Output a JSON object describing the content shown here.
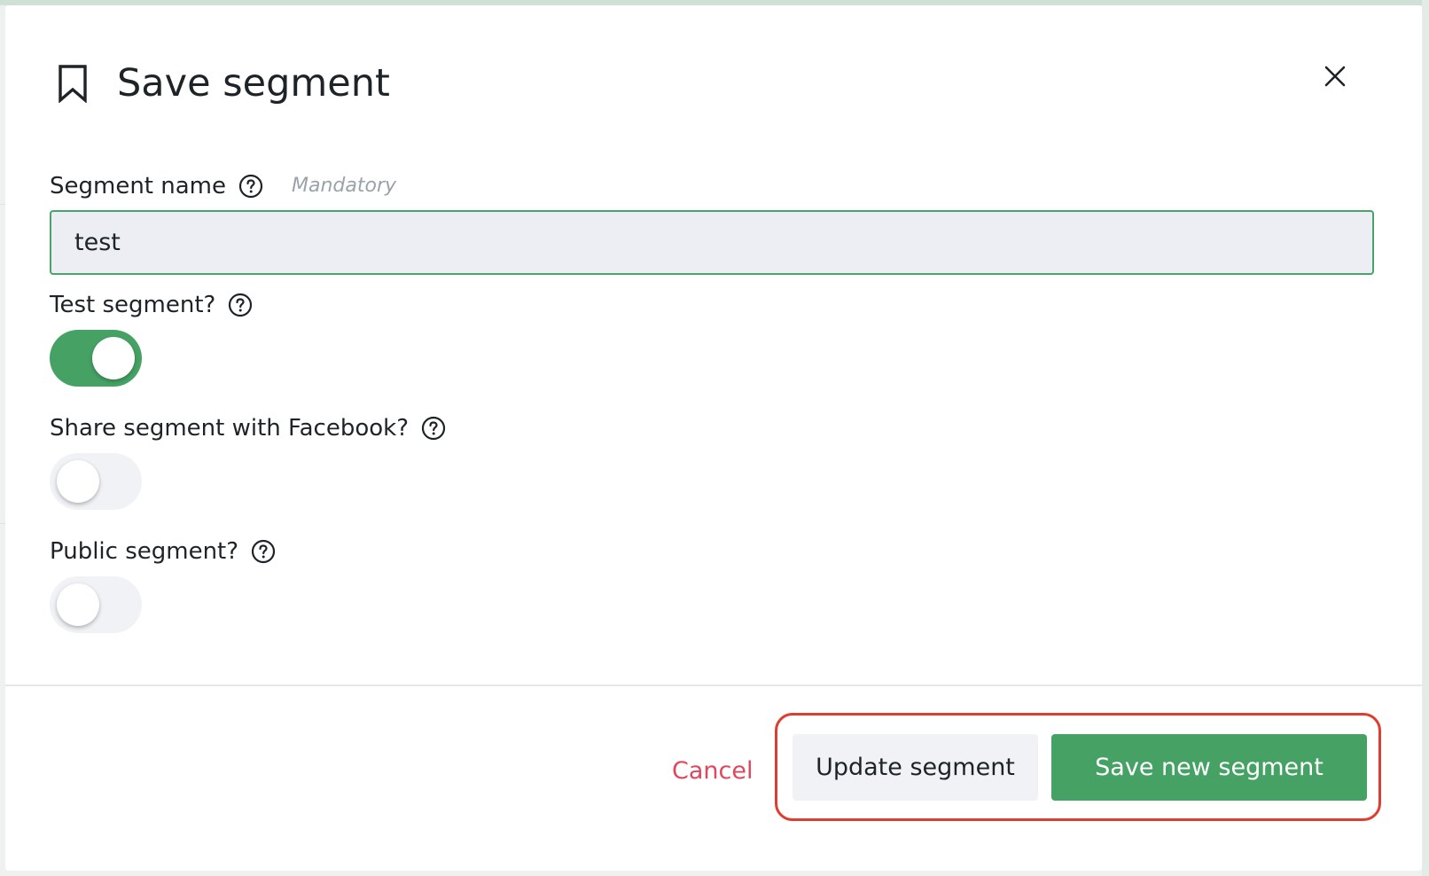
{
  "dialog": {
    "title": "Save segment",
    "icon": "bookmark-icon",
    "close_icon": "close-icon"
  },
  "fields": {
    "segment_name": {
      "label": "Segment name",
      "hint": "Mandatory",
      "value": "test"
    },
    "test_segment": {
      "label": "Test segment?",
      "enabled": true
    },
    "share_facebook": {
      "label": "Share segment with Facebook?",
      "enabled": false
    },
    "public_segment": {
      "label": "Public segment?",
      "enabled": false
    }
  },
  "footer": {
    "cancel_label": "Cancel",
    "update_label": "Update segment",
    "save_new_label": "Save new segment"
  },
  "colors": {
    "accent_green": "#46a264",
    "cancel_red": "#e0475e",
    "highlight_red": "#e03d2f"
  }
}
